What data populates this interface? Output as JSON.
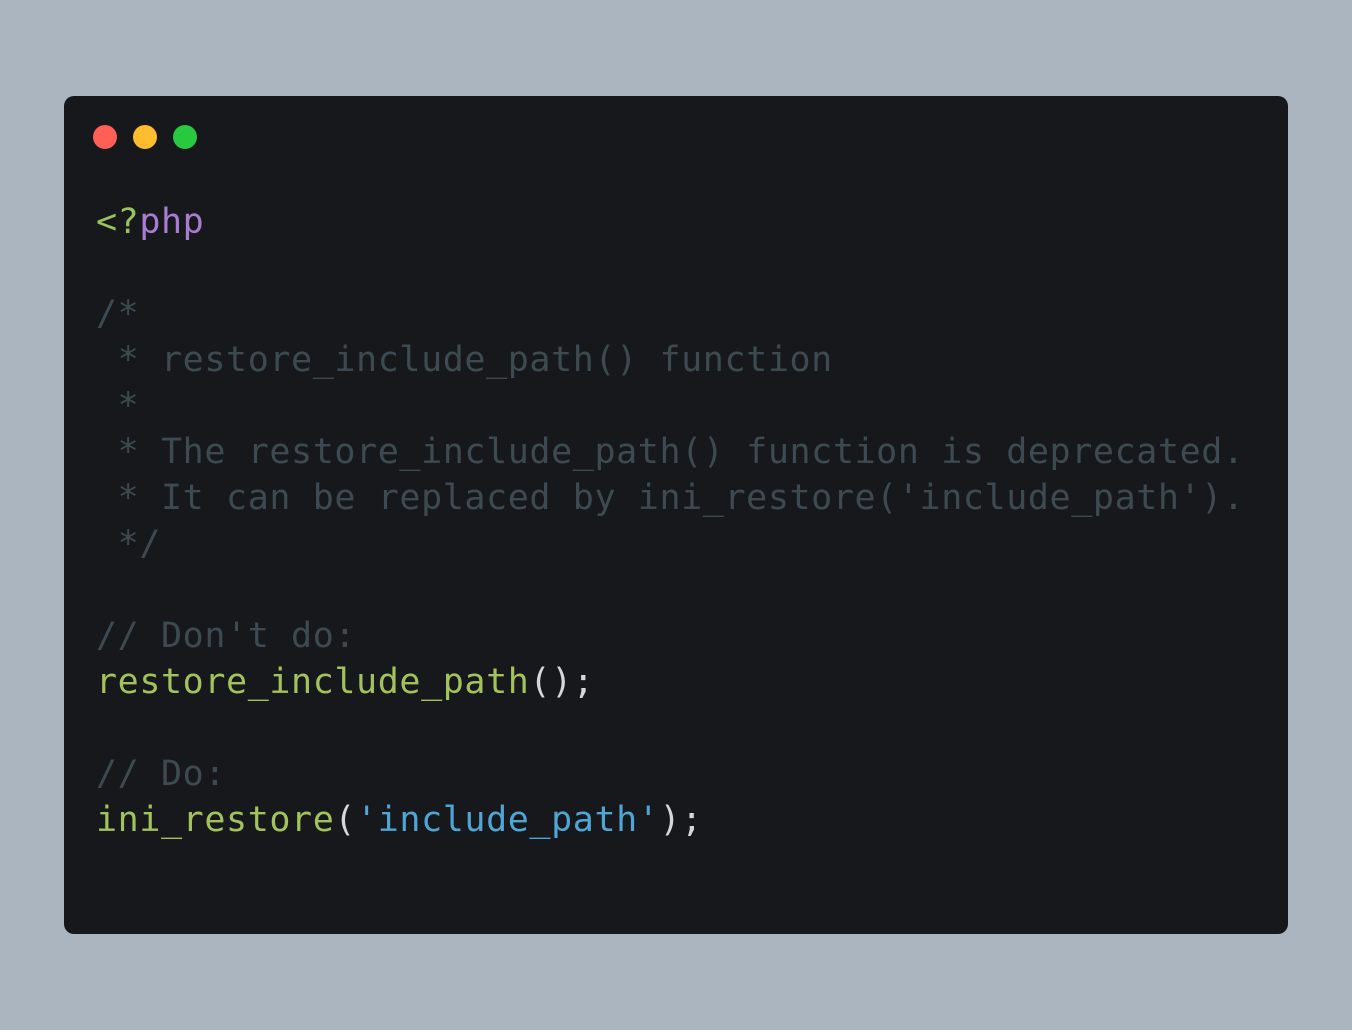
{
  "window": {
    "controls": {
      "close_color": "#ff5f57",
      "minimize_color": "#febc2e",
      "maximize_color": "#28c840"
    }
  },
  "code": {
    "language": "php",
    "colors": {
      "background": "#17181b",
      "tag": "#98c35e",
      "keyword": "#a87ccf",
      "comment": "#3e4a52",
      "function": "#a3c25c",
      "string": "#4fa6d4",
      "punctuation": "#d4d7dc"
    },
    "open_tag": "<?",
    "open_tag_name": "php",
    "block_comment": [
      "/*",
      " * restore_include_path() function",
      " *",
      " * The restore_include_path() function is deprecated.",
      " * It can be replaced by ini_restore('include_path').",
      " */"
    ],
    "dont_comment": "// Don't do:",
    "dont_call_fn": "restore_include_path",
    "dont_call_args": "();",
    "do_comment": "// Do:",
    "do_call_fn": "ini_restore",
    "do_call_open": "(",
    "do_call_arg": "'include_path'",
    "do_call_close": ");"
  }
}
